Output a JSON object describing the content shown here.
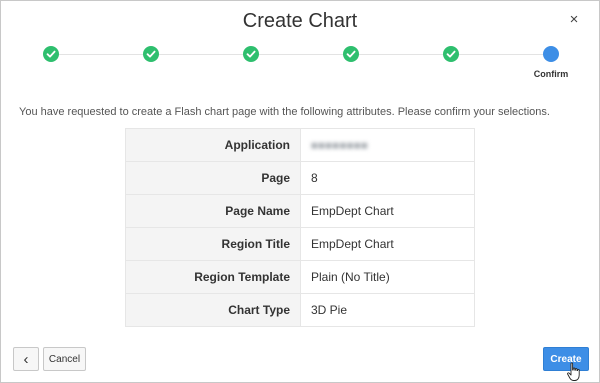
{
  "dialog": {
    "title": "Create Chart",
    "close_icon": "close-icon",
    "close_glyph": "×"
  },
  "wizard": {
    "steps": [
      {
        "status": "complete",
        "label": ""
      },
      {
        "status": "complete",
        "label": ""
      },
      {
        "status": "complete",
        "label": ""
      },
      {
        "status": "complete",
        "label": ""
      },
      {
        "status": "complete",
        "label": ""
      },
      {
        "status": "current",
        "label": "Confirm"
      }
    ],
    "complete_color": "#2ebf6e",
    "current_color": "#3d8ee6"
  },
  "intro_text": "You have requested to create a Flash chart page with the following attributes. Please confirm your selections.",
  "summary": [
    {
      "label": "Application",
      "value": "",
      "blurred": true
    },
    {
      "label": "Page",
      "value": "8"
    },
    {
      "label": "Page Name",
      "value": "EmpDept Chart"
    },
    {
      "label": "Region Title",
      "value": "EmpDept Chart"
    },
    {
      "label": "Region Template",
      "value": "Plain (No Title)"
    },
    {
      "label": "Chart Type",
      "value": "3D Pie"
    }
  ],
  "footer": {
    "prev_icon": "chevron-left-icon",
    "prev_glyph": "‹",
    "cancel_label": "Cancel",
    "create_label": "Create",
    "accent_color": "#3d8ee6"
  }
}
